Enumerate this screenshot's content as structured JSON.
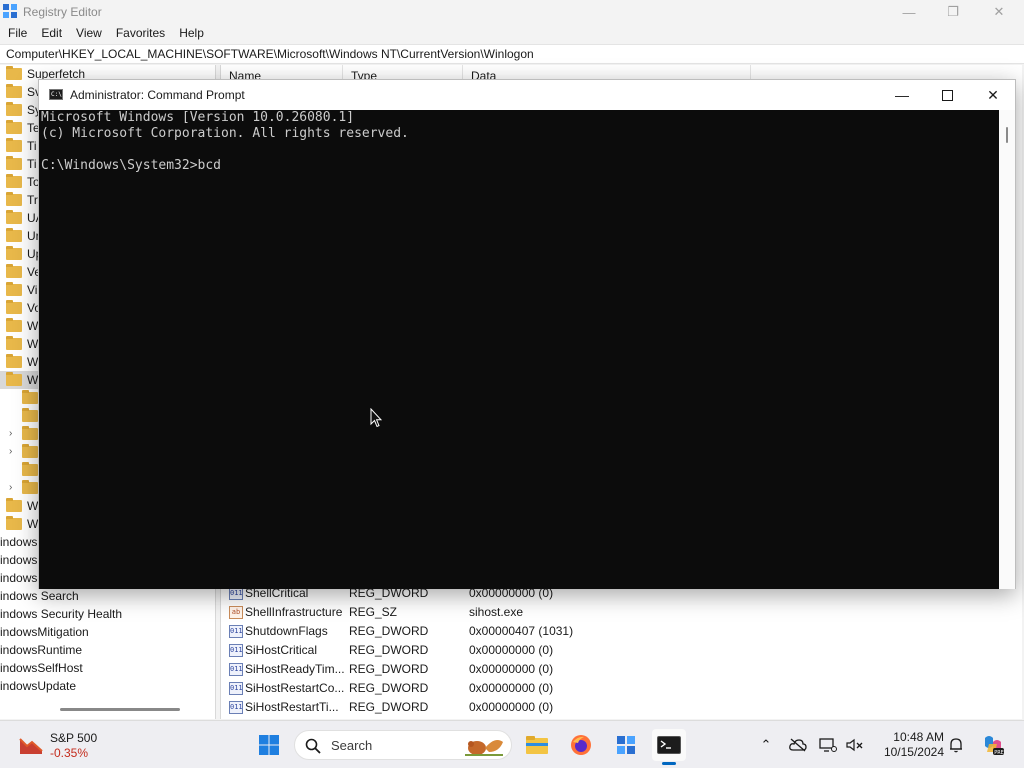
{
  "registry_editor": {
    "title": "Registry Editor",
    "menu": [
      "File",
      "Edit",
      "View",
      "Favorites",
      "Help"
    ],
    "address": "Computer\\HKEY_LOCAL_MACHINE\\SOFTWARE\\Microsoft\\Windows NT\\CurrentVersion\\Winlogon",
    "tree_items": [
      {
        "label": "Superfetch",
        "folder": true,
        "indent": 0
      },
      {
        "label": "Sv",
        "folder": true,
        "indent": 0
      },
      {
        "label": "Sy",
        "folder": true,
        "indent": 0
      },
      {
        "label": "Te",
        "folder": true,
        "indent": 0
      },
      {
        "label": "Ti",
        "folder": true,
        "indent": 0
      },
      {
        "label": "Ti",
        "folder": true,
        "indent": 0
      },
      {
        "label": "To",
        "folder": true,
        "indent": 0
      },
      {
        "label": "Tr",
        "folder": true,
        "indent": 0
      },
      {
        "label": "UA",
        "folder": true,
        "indent": 0
      },
      {
        "label": "Ur",
        "folder": true,
        "indent": 0
      },
      {
        "label": "Up",
        "folder": true,
        "indent": 0
      },
      {
        "label": "Ve",
        "folder": true,
        "indent": 0
      },
      {
        "label": "Vi",
        "folder": true,
        "indent": 0
      },
      {
        "label": "Vo",
        "folder": true,
        "indent": 0
      },
      {
        "label": "W",
        "folder": true,
        "indent": 0
      },
      {
        "label": "W",
        "folder": true,
        "indent": 0
      },
      {
        "label": "W",
        "folder": true,
        "indent": 0
      },
      {
        "label": "W",
        "folder": true,
        "indent": 0,
        "selected": true
      },
      {
        "label": "",
        "folder": true,
        "indent": 1
      },
      {
        "label": "",
        "folder": true,
        "indent": 1
      },
      {
        "label": "",
        "folder": true,
        "indent": 1,
        "chevron": true
      },
      {
        "label": "",
        "folder": true,
        "indent": 1,
        "chevron": true
      },
      {
        "label": "",
        "folder": true,
        "indent": 1
      },
      {
        "label": "",
        "folder": true,
        "indent": 1,
        "chevron": true
      },
      {
        "label": "W",
        "folder": true,
        "indent": 0
      },
      {
        "label": "W",
        "folder": true,
        "indent": 0
      },
      {
        "label": "indows",
        "folder": false,
        "indent": 0
      },
      {
        "label": "indows",
        "folder": false,
        "indent": 0
      },
      {
        "label": "indows",
        "folder": false,
        "indent": 0
      },
      {
        "label": "indows Search",
        "folder": false,
        "indent": 0
      },
      {
        "label": "indows Security Health",
        "folder": false,
        "indent": 0
      },
      {
        "label": "indowsMitigation",
        "folder": false,
        "indent": 0
      },
      {
        "label": "indowsRuntime",
        "folder": false,
        "indent": 0
      },
      {
        "label": "indowsSelfHost",
        "folder": false,
        "indent": 0
      },
      {
        "label": "indowsUpdate",
        "folder": false,
        "indent": 0
      }
    ],
    "columns": [
      "Name",
      "Type",
      "Data"
    ],
    "values": [
      {
        "name": "ShellCritical",
        "type": "REG_DWORD",
        "data": "0x00000000 (0)",
        "kind": "dword"
      },
      {
        "name": "ShellInfrastructure",
        "type": "REG_SZ",
        "data": "sihost.exe",
        "kind": "sz"
      },
      {
        "name": "ShutdownFlags",
        "type": "REG_DWORD",
        "data": "0x00000407 (1031)",
        "kind": "dword"
      },
      {
        "name": "SiHostCritical",
        "type": "REG_DWORD",
        "data": "0x00000000 (0)",
        "kind": "dword"
      },
      {
        "name": "SiHostReadyTim...",
        "type": "REG_DWORD",
        "data": "0x00000000 (0)",
        "kind": "dword"
      },
      {
        "name": "SiHostRestartCo...",
        "type": "REG_DWORD",
        "data": "0x00000000 (0)",
        "kind": "dword"
      },
      {
        "name": "SiHostRestartTi...",
        "type": "REG_DWORD",
        "data": "0x00000000 (0)",
        "kind": "dword"
      }
    ]
  },
  "cmd": {
    "title": "Administrator: Command Prompt",
    "lines": [
      "Microsoft Windows [Version 10.0.26080.1]",
      "(c) Microsoft Corporation. All rights reserved.",
      "",
      "C:\\Windows\\System32>bcd"
    ]
  },
  "taskbar": {
    "widget_name": "S&P 500",
    "widget_value": "-0.35%",
    "search_label": "Search",
    "time": "10:48 AM",
    "date": "10/15/2024",
    "apps": [
      "start-icon",
      "search-icon",
      "file-explorer-icon",
      "firefox-icon",
      "registry-editor-icon",
      "terminal-icon"
    ],
    "tray": [
      "chevron-up-icon",
      "onedrive-icon",
      "network-icon",
      "volume-icon",
      "notification-bell-icon",
      "copilot-icon"
    ]
  },
  "colors": {
    "accent": "#0067c0",
    "console_bg": "#0c0c0c",
    "console_text": "#cccccc",
    "negative": "#c42b1c",
    "folder": "#e8b84a"
  }
}
